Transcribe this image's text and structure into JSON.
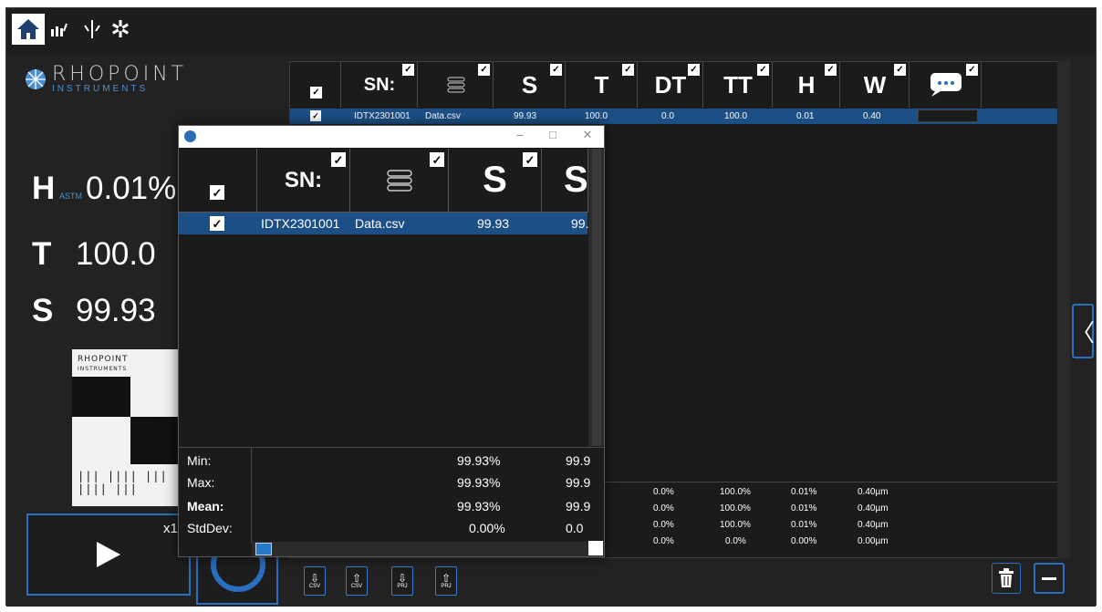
{
  "nav": {
    "icons": [
      "home-icon",
      "chart-icon",
      "measure-icon",
      "gear-icon"
    ]
  },
  "brand": {
    "name": "RHOPOINT",
    "sub": "INSTRUMENTS"
  },
  "readings": [
    {
      "label": "H",
      "sub": "ASTM",
      "value": "0.01%"
    },
    {
      "label": "T",
      "sub": "",
      "value": "100.0"
    },
    {
      "label": "S",
      "sub": "",
      "value": "99.93"
    }
  ],
  "card": {
    "brand": "RHOPOINT",
    "sub": "INSTRUMENTS",
    "barcode": "||| |||| ||| |||| |||"
  },
  "controls": {
    "repeat_label": "x1"
  },
  "grid": {
    "headers": [
      "",
      "SN:",
      "",
      "S",
      "T",
      "DT",
      "TT",
      "H",
      "W",
      ""
    ],
    "row": {
      "sn": "IDTX2301001",
      "file": "Data.csv",
      "s": "99.93",
      "t": "100.0",
      "dt": "0.0",
      "tt": "100.0",
      "h": "0.01",
      "w": "0.40"
    },
    "stats": {
      "dt": [
        "0.0%",
        "0.0%",
        "0.0%",
        "0.0%"
      ],
      "tt": [
        "100.0%",
        "100.0%",
        "100.0%",
        "0.0%"
      ],
      "h": [
        "0.01%",
        "0.01%",
        "0.01%",
        "0.00%"
      ],
      "w": [
        "0.40µm",
        "0.40µm",
        "0.40µm",
        "0.00µm"
      ]
    }
  },
  "io_buttons": [
    {
      "icon": "download-icon",
      "glyph": "⇩",
      "label": "CSV"
    },
    {
      "icon": "upload-icon",
      "glyph": "⇧",
      "label": "CSV"
    },
    {
      "icon": "download-icon",
      "glyph": "⇩",
      "label": "PRJ"
    },
    {
      "icon": "upload-icon",
      "glyph": "⇧",
      "label": "PRJ"
    }
  ],
  "popup": {
    "controls": {
      "minimize": "–",
      "maximize": "□",
      "close": "✕"
    },
    "headers": [
      "",
      "SN:",
      "",
      "S",
      "S"
    ],
    "row": {
      "sn": "IDTX2301001",
      "file": "Data.csv",
      "s": "99.93",
      "s2": "99."
    },
    "stat_labels": [
      "Min:",
      "Max:",
      "Mean:",
      "StdDev:"
    ],
    "s_values": [
      "99.93%",
      "99.93%",
      "99.93%",
      "0.00%"
    ],
    "s2_values": [
      "99.9",
      "99.9",
      "99.9",
      "0.0"
    ]
  },
  "colors": {
    "accent": "#2a6fc0",
    "row_selected": "#1d4f87",
    "background": "#1f1f1f"
  }
}
